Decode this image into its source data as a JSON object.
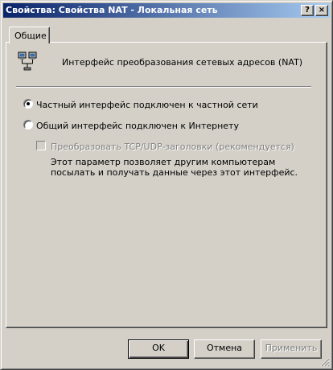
{
  "window": {
    "title": "Свойства: Свойства NAT - Локальная сеть",
    "help_button": "?",
    "close_button": "×"
  },
  "tabs": [
    {
      "label": "Общие",
      "active": true
    }
  ],
  "general": {
    "icon": "network-connection-icon",
    "heading": "Интерфейс преобразования сетевых адресов (NAT)",
    "options": [
      {
        "label": "Частный интерфейс подключен к частной сети",
        "selected": true
      },
      {
        "label": "Общий интерфейс подключен к Интернету",
        "selected": false
      }
    ],
    "translate_headers": {
      "label": "Преобразовать TCP/UDP-заголовки (рекомендуется)",
      "checked": false,
      "enabled": false
    },
    "description": "Этот параметр позволяет другим компьютерам посылать и получать данные через этот интерфейс."
  },
  "buttons": {
    "ok": "OK",
    "cancel": "Отмена",
    "apply": "Применить"
  },
  "colors": {
    "title_gradient_start": "#0a246a",
    "title_gradient_end": "#a6caf0",
    "face": "#d4d0c8"
  }
}
